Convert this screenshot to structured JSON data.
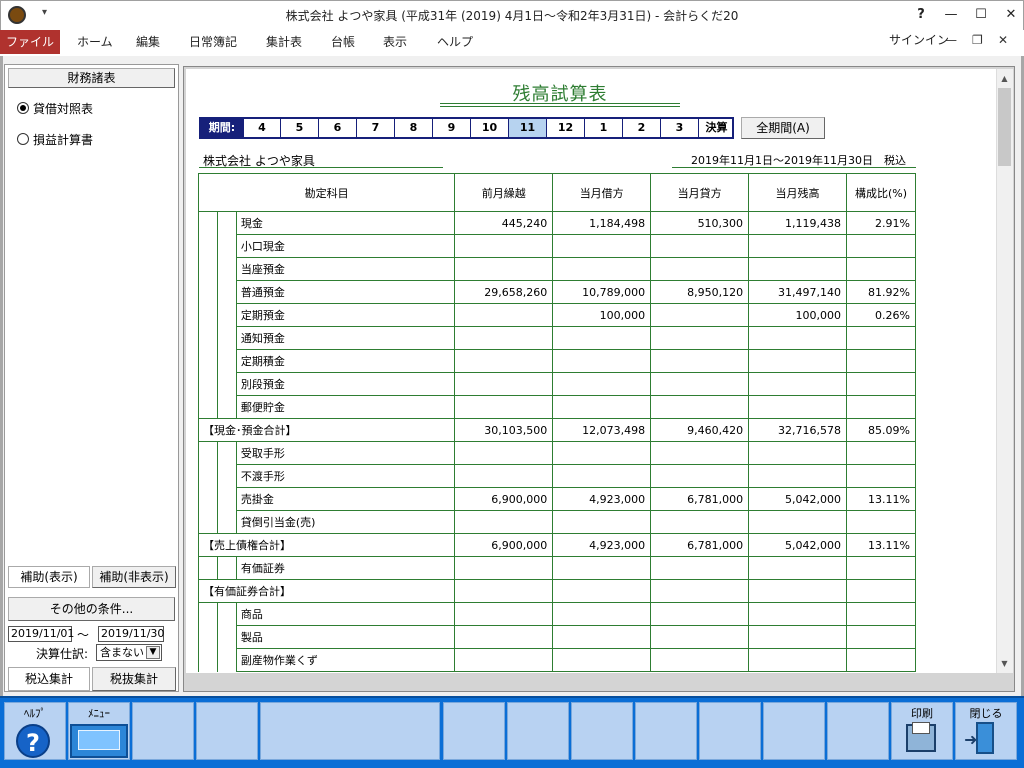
{
  "window": {
    "title": "株式会社 よつや家具 (平成31年 (2019) 4月1日～令和2年3月31日) - 会計らくだ20",
    "help_icon": "?"
  },
  "menu": {
    "file": "ファイル",
    "items": [
      "ホーム",
      "編集",
      "日常簿記",
      "集計表",
      "台帳",
      "表示",
      "ヘルプ"
    ],
    "signin": "サインイン"
  },
  "left": {
    "financial_btn": "財務諸表",
    "radio1": "貸借対照表",
    "radio2": "損益計算書",
    "tab_show": "補助(表示)",
    "tab_hide": "補助(非表示)",
    "cond_btn": "その他の条件...",
    "date_from": "2019/11/01",
    "tilde": "～",
    "date_to": "2019/11/30",
    "kessan_label": "決算仕訳:",
    "kessan_value": "含まない",
    "zeikomi": "税込集計",
    "zeinuki": "税抜集計"
  },
  "report": {
    "title": "残高試算表",
    "period_label": "期間:",
    "periods": [
      "4",
      "5",
      "6",
      "7",
      "8",
      "9",
      "10",
      "11",
      "12",
      "1",
      "2",
      "3",
      "決算"
    ],
    "selected_period": "11",
    "all_period_btn": "全期間(A)",
    "company": "株式会社 よつや家具",
    "daterange": "2019年11月1日～2019年11月30日　税込",
    "headers": [
      "勘定科目",
      "前月繰越",
      "当月借方",
      "当月貸方",
      "当月残高",
      "構成比(%)"
    ],
    "rows": [
      {
        "name": "現金",
        "level": 2,
        "prev": "445,240",
        "debit": "1,184,498",
        "credit": "510,300",
        "balance": "1,119,438",
        "ratio": "2.91%"
      },
      {
        "name": "小口現金",
        "level": 2,
        "prev": "",
        "debit": "",
        "credit": "",
        "balance": "",
        "ratio": ""
      },
      {
        "name": "当座預金",
        "level": 2,
        "prev": "",
        "debit": "",
        "credit": "",
        "balance": "",
        "ratio": ""
      },
      {
        "name": "普通預金",
        "level": 2,
        "prev": "29,658,260",
        "debit": "10,789,000",
        "credit": "8,950,120",
        "balance": "31,497,140",
        "ratio": "81.92%"
      },
      {
        "name": "定期預金",
        "level": 2,
        "prev": "",
        "debit": "100,000",
        "credit": "",
        "balance": "100,000",
        "ratio": "0.26%"
      },
      {
        "name": "通知預金",
        "level": 2,
        "prev": "",
        "debit": "",
        "credit": "",
        "balance": "",
        "ratio": ""
      },
      {
        "name": "定期積金",
        "level": 2,
        "prev": "",
        "debit": "",
        "credit": "",
        "balance": "",
        "ratio": ""
      },
      {
        "name": "別段預金",
        "level": 2,
        "prev": "",
        "debit": "",
        "credit": "",
        "balance": "",
        "ratio": ""
      },
      {
        "name": "郵便貯金",
        "level": 2,
        "prev": "",
        "debit": "",
        "credit": "",
        "balance": "",
        "ratio": ""
      },
      {
        "name": "【現金･預金合計】",
        "level": 1,
        "prev": "30,103,500",
        "debit": "12,073,498",
        "credit": "9,460,420",
        "balance": "32,716,578",
        "ratio": "85.09%"
      },
      {
        "name": "受取手形",
        "level": 2,
        "prev": "",
        "debit": "",
        "credit": "",
        "balance": "",
        "ratio": ""
      },
      {
        "name": "不渡手形",
        "level": 2,
        "prev": "",
        "debit": "",
        "credit": "",
        "balance": "",
        "ratio": ""
      },
      {
        "name": "売掛金",
        "level": 2,
        "prev": "6,900,000",
        "debit": "4,923,000",
        "credit": "6,781,000",
        "balance": "5,042,000",
        "ratio": "13.11%"
      },
      {
        "name": "貸倒引当金(売)",
        "level": 2,
        "prev": "",
        "debit": "",
        "credit": "",
        "balance": "",
        "ratio": ""
      },
      {
        "name": "【売上債権合計】",
        "level": 1,
        "prev": "6,900,000",
        "debit": "4,923,000",
        "credit": "6,781,000",
        "balance": "5,042,000",
        "ratio": "13.11%"
      },
      {
        "name": "有価証券",
        "level": 2,
        "prev": "",
        "debit": "",
        "credit": "",
        "balance": "",
        "ratio": ""
      },
      {
        "name": "【有価証券合計】",
        "level": 1,
        "prev": "",
        "debit": "",
        "credit": "",
        "balance": "",
        "ratio": ""
      },
      {
        "name": "商品",
        "level": 2,
        "prev": "",
        "debit": "",
        "credit": "",
        "balance": "",
        "ratio": ""
      },
      {
        "name": "製品",
        "level": 2,
        "prev": "",
        "debit": "",
        "credit": "",
        "balance": "",
        "ratio": ""
      },
      {
        "name": "副産物作業くず",
        "level": 2,
        "prev": "",
        "debit": "",
        "credit": "",
        "balance": "",
        "ratio": ""
      }
    ]
  },
  "fbar": {
    "help": "ﾍﾙﾌﾟ",
    "menu": "ﾒﾆｭｰ",
    "print": "印刷",
    "close": "閉じる"
  },
  "icons": {
    "help": "question-circle-icon",
    "menu": "menu-screen-icon",
    "print": "printer-icon",
    "close": "exit-door-icon"
  }
}
